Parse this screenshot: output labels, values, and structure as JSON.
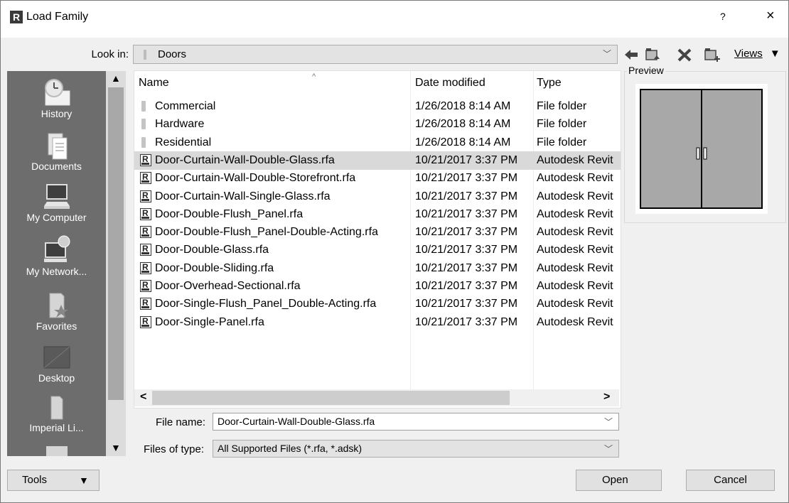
{
  "window": {
    "title": "Load Family",
    "app_icon_letter": "R",
    "help_label": "?",
    "close_label": "×"
  },
  "lookin": {
    "label": "Look in:",
    "value": "Doors"
  },
  "toolbar": {
    "icons": [
      "back-arrow-icon",
      "up-one-level-icon",
      "delete-icon",
      "new-folder-icon"
    ],
    "views_label": "Views"
  },
  "places": [
    {
      "label": "History",
      "icon": "history-icon"
    },
    {
      "label": "Documents",
      "icon": "documents-icon"
    },
    {
      "label": "My Computer",
      "icon": "computer-icon"
    },
    {
      "label": "My Network...",
      "icon": "network-icon"
    },
    {
      "label": "Favorites",
      "icon": "favorites-icon"
    },
    {
      "label": "Desktop",
      "icon": "desktop-icon"
    },
    {
      "label": "Imperial Li...",
      "icon": "folder-icon"
    }
  ],
  "filelist": {
    "columns": [
      "Name",
      "Date modified",
      "Type"
    ],
    "rows": [
      {
        "name": "Commercial",
        "date": "1/26/2018 8:14 AM",
        "type": "File folder",
        "kind": "folder"
      },
      {
        "name": "Hardware",
        "date": "1/26/2018 8:14 AM",
        "type": "File folder",
        "kind": "folder"
      },
      {
        "name": "Residential",
        "date": "1/26/2018 8:14 AM",
        "type": "File folder",
        "kind": "folder"
      },
      {
        "name": "Door-Curtain-Wall-Double-Glass.rfa",
        "date": "10/21/2017 3:37 PM",
        "type": "Autodesk Revit",
        "kind": "rfa",
        "selected": true
      },
      {
        "name": "Door-Curtain-Wall-Double-Storefront.rfa",
        "date": "10/21/2017 3:37 PM",
        "type": "Autodesk Revit",
        "kind": "rfa"
      },
      {
        "name": "Door-Curtain-Wall-Single-Glass.rfa",
        "date": "10/21/2017 3:37 PM",
        "type": "Autodesk Revit",
        "kind": "rfa"
      },
      {
        "name": "Door-Double-Flush_Panel.rfa",
        "date": "10/21/2017 3:37 PM",
        "type": "Autodesk Revit",
        "kind": "rfa"
      },
      {
        "name": "Door-Double-Flush_Panel-Double-Acting.rfa",
        "date": "10/21/2017 3:37 PM",
        "type": "Autodesk Revit",
        "kind": "rfa"
      },
      {
        "name": "Door-Double-Glass.rfa",
        "date": "10/21/2017 3:37 PM",
        "type": "Autodesk Revit",
        "kind": "rfa"
      },
      {
        "name": "Door-Double-Sliding.rfa",
        "date": "10/21/2017 3:37 PM",
        "type": "Autodesk Revit",
        "kind": "rfa"
      },
      {
        "name": "Door-Overhead-Sectional.rfa",
        "date": "10/21/2017 3:37 PM",
        "type": "Autodesk Revit",
        "kind": "rfa"
      },
      {
        "name": "Door-Single-Flush_Panel_Double-Acting.rfa",
        "date": "10/21/2017 3:37 PM",
        "type": "Autodesk Revit",
        "kind": "rfa"
      },
      {
        "name": "Door-Single-Panel.rfa",
        "date": "10/21/2017 3:37 PM",
        "type": "Autodesk Revit",
        "kind": "rfa"
      }
    ]
  },
  "preview": {
    "label": "Preview"
  },
  "filename": {
    "label": "File name:",
    "value": "Door-Curtain-Wall-Double-Glass.rfa"
  },
  "filetype": {
    "label": "Files of type:",
    "value": "All Supported Files  (*.rfa, *.adsk)"
  },
  "buttons": {
    "tools": "Tools",
    "open": "Open",
    "cancel": "Cancel"
  },
  "colors": {
    "places_bg": "#6d6d6d",
    "selection": "#d9d9d9",
    "door_fill": "#a8a8a8"
  }
}
